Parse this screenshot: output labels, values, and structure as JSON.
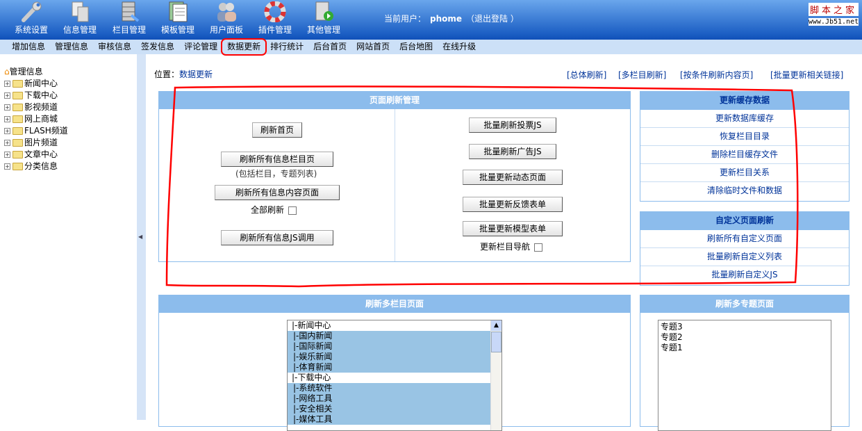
{
  "header": {
    "tools": [
      {
        "label": "系统设置",
        "icon": "wrench-icon"
      },
      {
        "label": "信息管理",
        "icon": "documents-icon"
      },
      {
        "label": "栏目管理",
        "icon": "database-icon"
      },
      {
        "label": "模板管理",
        "icon": "template-icon"
      },
      {
        "label": "用户面板",
        "icon": "users-icon"
      },
      {
        "label": "插件管理",
        "icon": "lifebuoy-icon"
      },
      {
        "label": "其他管理",
        "icon": "play-doc-icon"
      }
    ],
    "user_label": "当前用户：",
    "username": "phome",
    "logout": "（退出登陆 ）",
    "logo_cn": "脚本之家",
    "logo_url": "www.Jb51.net"
  },
  "menu": [
    "增加信息",
    "管理信息",
    "审核信息",
    "签发信息",
    "评论管理",
    "数据更新",
    "排行统计",
    "后台首页",
    "网站首页",
    "后台地图",
    "在线升级"
  ],
  "sidebar": {
    "root": "管理信息",
    "items": [
      "新闻中心",
      "下载中心",
      "影视频道",
      "网上商城",
      "FLASH频道",
      "图片频道",
      "文章中心",
      "分类信息"
    ]
  },
  "location": {
    "label": "位置：",
    "current": "数据更新"
  },
  "top_links": [
    "[总体刷新]",
    "[多栏目刷新]",
    "[按条件刷新内容页]",
    "[批量更新相关链接]"
  ],
  "page_refresh": {
    "title": "页面刷新管理",
    "refresh_home": "刷新首页",
    "refresh_all_list": "刷新所有信息栏目页",
    "list_note": "(包括栏目，专题列表)",
    "refresh_all_content": "刷新所有信息内容页面",
    "all_refresh": "全部刷新",
    "refresh_js": "刷新所有信息JS调用",
    "vote_js": "批量刷新投票JS",
    "ad_js": "批量刷新广告JS",
    "dynamic": "批量更新动态页面",
    "feedback": "批量更新反馈表单",
    "model_form": "批量更新模型表单",
    "class_nav": "更新栏目导航"
  },
  "cache": {
    "title": "更新缓存数据",
    "items": [
      "更新数据库缓存",
      "恢复栏目目录",
      "删除栏目缓存文件",
      "更新栏目关系",
      "清除临时文件和数据"
    ]
  },
  "custom": {
    "title": "自定义页面刷新",
    "items": [
      "刷新所有自定义页面",
      "批量刷新自定义列表",
      "批量刷新自定义JS"
    ]
  },
  "multi_class": {
    "title": "刷新多栏目页面",
    "options": [
      "|-新闻中心",
      "  |-国内新闻",
      "  |-国际新闻",
      "  |-娱乐新闻",
      "  |-体育新闻",
      "|-下载中心",
      "  |-系统软件",
      "  |-网络工具",
      "  |-安全相关",
      "  |-媒体工具"
    ]
  },
  "multi_topic": {
    "title": "刷新多专题页面",
    "options": [
      "专题3",
      "专题2",
      "专题1"
    ]
  }
}
